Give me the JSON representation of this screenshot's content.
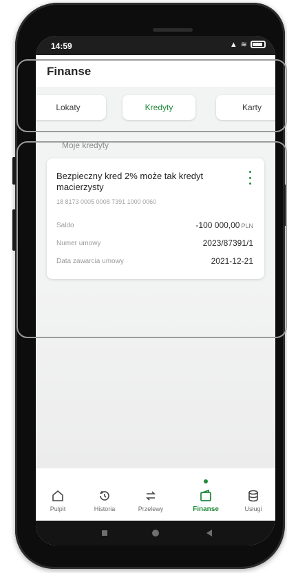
{
  "status_bar": {
    "time": "14:59",
    "signal_icon": "signal-icon",
    "wifi_icon": "wifi-icon",
    "battery_icon": "battery-icon"
  },
  "header": {
    "title": "Finanse"
  },
  "tabs": [
    {
      "label": "Lokaty",
      "active": false
    },
    {
      "label": "Kredyty",
      "active": true
    },
    {
      "label": "Karty",
      "active": false
    }
  ],
  "section_label": "Moje kredyty",
  "credit": {
    "name": "Bezpieczny kred 2% może tak kredyt macierzysty",
    "account_number": "18 8173 0005 0008 7391 1000 0060",
    "rows": [
      {
        "label": "Saldo",
        "value": "-100 000,00",
        "currency": "PLN"
      },
      {
        "label": "Numer umowy",
        "value": "2023/87391/1"
      },
      {
        "label": "Data zawarcia umowy",
        "value": "2021-12-21"
      }
    ],
    "menu_icon": "more-vertical-icon"
  },
  "bottom_nav": [
    {
      "label": "Pulpit",
      "icon": "home-icon",
      "active": false
    },
    {
      "label": "Historia",
      "icon": "history-icon",
      "active": false
    },
    {
      "label": "Przelewy",
      "icon": "transfer-icon",
      "active": false
    },
    {
      "label": "Finanse",
      "icon": "wallet-icon",
      "active": true
    },
    {
      "label": "Usługi",
      "icon": "database-icon",
      "active": false
    }
  ],
  "colors": {
    "accent": "#228a3c",
    "background": "#f2f3f3",
    "card": "#ffffff",
    "highlight_outline": "#9c9c9c"
  }
}
